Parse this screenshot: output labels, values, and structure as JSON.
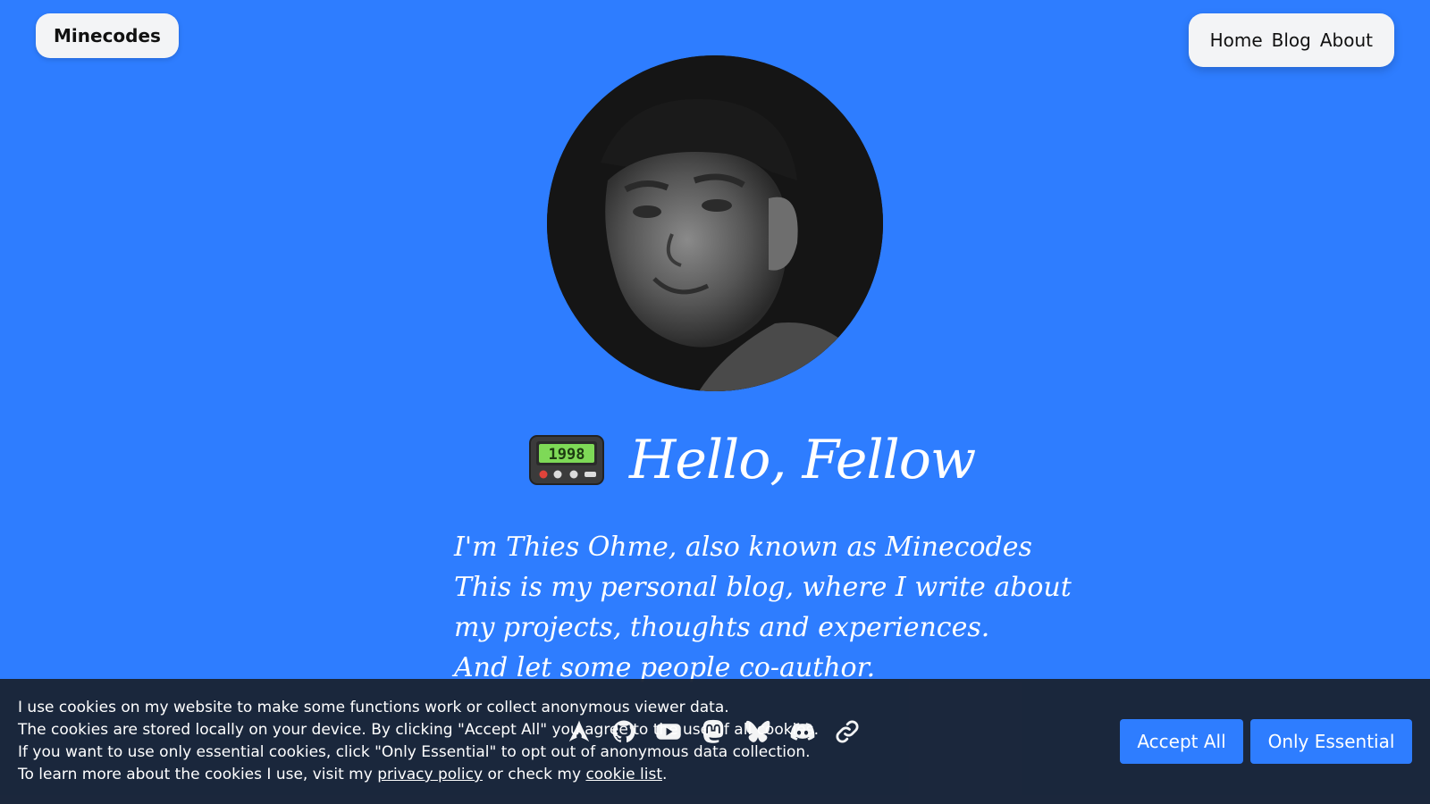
{
  "header": {
    "brand": "Minecodes",
    "nav": [
      {
        "label": "Home"
      },
      {
        "label": "Blog"
      },
      {
        "label": "About"
      }
    ]
  },
  "hero": {
    "pager_display": "1998",
    "heading": "Hello, Fellow",
    "intro_lines": [
      "I'm Thies Ohme, also known as Minecodes",
      "This is my personal blog, where I write about",
      "my projects, thoughts and experiences.",
      "And let some people co-author."
    ]
  },
  "socials": [
    {
      "icon": "arch-linux-icon"
    },
    {
      "icon": "github-icon"
    },
    {
      "icon": "youtube-icon"
    },
    {
      "icon": "mastodon-icon"
    },
    {
      "icon": "bluesky-icon"
    },
    {
      "icon": "discord-icon"
    },
    {
      "icon": "link-icon"
    }
  ],
  "cookie_banner": {
    "line1": "I use cookies on my website to make some functions work or collect anonymous viewer data.",
    "line2": "The cookies are stored locally on your device. By clicking \"Accept All\" you agree to the use of all cookies.",
    "line3": "If you want to use only essential cookies, click \"Only Essential\" to opt out of anonymous data collection.",
    "line4_prefix": "To learn more about the cookies I use, visit my",
    "privacy_link": "privacy policy",
    "line4_middle": "or check my",
    "cookie_link": "cookie list",
    "line4_suffix": ".",
    "accept_all": "Accept All",
    "only_essential": "Only Essential"
  },
  "colors": {
    "background": "#2e7dff",
    "banner": "#1a2436",
    "button": "#2e7dff",
    "nav_pill": "#f3f4f6"
  }
}
